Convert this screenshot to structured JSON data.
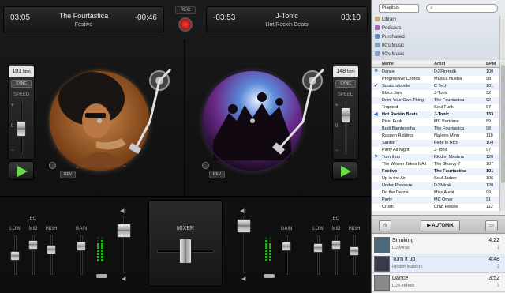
{
  "deck_left": {
    "elapsed": "03:05",
    "title": "The Fourtastica",
    "subtitle": "Festivo",
    "remaining": "-00:46",
    "bpm": "101",
    "bpm_unit": "bpm",
    "sync": "SYNC",
    "speed": "SPEED",
    "rev": "REV",
    "pitch_marks": [
      "+",
      "0",
      "−"
    ]
  },
  "deck_right": {
    "elapsed": "-03:53",
    "title": "J-Tonic",
    "subtitle": "Hot Rockin Beats",
    "remaining": "03:10",
    "bpm": "148",
    "bpm_unit": "bpm",
    "sync": "SYNC",
    "speed": "SPEED",
    "rev": "REV",
    "pitch_marks": [
      "+",
      "0",
      "−"
    ]
  },
  "rec_label": "REC",
  "mixer": {
    "label": "MIXER",
    "eq": "EQ",
    "low": "LOW",
    "mid": "MID",
    "high": "HIGH",
    "gain": "GAIN"
  },
  "itunes": {
    "source_select": "Playlists",
    "sources": [
      {
        "label": "Library",
        "color": "#c8a76a"
      },
      {
        "label": "Podcasts",
        "color": "#b061c6"
      },
      {
        "label": "Purchased",
        "color": "#6a8bc8"
      },
      {
        "label": "80's Music",
        "color": "#7fa0c8"
      },
      {
        "label": "90's Music",
        "color": "#7fa0c8"
      }
    ],
    "columns": {
      "name": "Name",
      "artist": "Artist",
      "bpm": "BPM"
    },
    "tracks": [
      {
        "mark": "flag",
        "name": "Dance",
        "artist": "DJ Fireredk",
        "bpm": "100"
      },
      {
        "mark": "",
        "name": "Progressive Chords",
        "artist": "Musica Nueba",
        "bpm": "98"
      },
      {
        "mark": "check",
        "name": "Scratchdoodle",
        "artist": "C Tech",
        "bpm": "101"
      },
      {
        "mark": "",
        "name": "Block Jam",
        "artist": "J-Tonic",
        "bpm": "92"
      },
      {
        "mark": "",
        "name": "Doin' Your Own Thing",
        "artist": "The Fourtastica",
        "bpm": "92"
      },
      {
        "mark": "",
        "name": "Trapped",
        "artist": "Soul Funk",
        "bpm": "97"
      },
      {
        "mark": "speaker",
        "name": "Hot Rockin Beats",
        "artist": "J-Tonic",
        "bpm": "133",
        "bold": true
      },
      {
        "mark": "",
        "name": "Pixel Funk",
        "artist": "MC Bartsime",
        "bpm": "89"
      },
      {
        "mark": "",
        "name": "Budi Bamboocha",
        "artist": "The Fourtastica",
        "bpm": "98"
      },
      {
        "mark": "",
        "name": "Rasoon Riddims",
        "artist": "Nallorie Minn",
        "bpm": "118"
      },
      {
        "mark": "",
        "name": "Santilo",
        "artist": "Fede le Rico",
        "bpm": "104"
      },
      {
        "mark": "",
        "name": "Party All Night",
        "artist": "J-Tonic",
        "bpm": "97"
      },
      {
        "mark": "flag",
        "name": "Turn it up",
        "artist": "Riddim Masters",
        "bpm": "120"
      },
      {
        "mark": "",
        "name": "The Winner Takes It All",
        "artist": "The Groovy 7",
        "bpm": "107"
      },
      {
        "mark": "",
        "name": "Festivo",
        "artist": "The Fourtastica",
        "bpm": "101",
        "bold": true
      },
      {
        "mark": "",
        "name": "Up in the Air",
        "artist": "Soul Jadzer",
        "bpm": "106"
      },
      {
        "mark": "",
        "name": "Under Pressure",
        "artist": "DJ Mirak",
        "bpm": "120"
      },
      {
        "mark": "",
        "name": "Do the Dance",
        "artist": "Miss Aural",
        "bpm": "99"
      },
      {
        "mark": "",
        "name": "Party",
        "artist": "MC Omar",
        "bpm": "91"
      },
      {
        "mark": "",
        "name": "Crush",
        "artist": "Crab People",
        "bpm": "112"
      }
    ],
    "automix": "AUTOMIX",
    "queue": [
      {
        "title": "Smoking",
        "artist": "DJ Mirak",
        "duration": "4:22",
        "count": "1"
      },
      {
        "title": "Turn it up",
        "artist": "Riddim Masters",
        "duration": "4:48",
        "count": "2"
      },
      {
        "title": "Dance",
        "artist": "DJ Fireredk",
        "duration": "3:52",
        "count": "3"
      }
    ]
  }
}
